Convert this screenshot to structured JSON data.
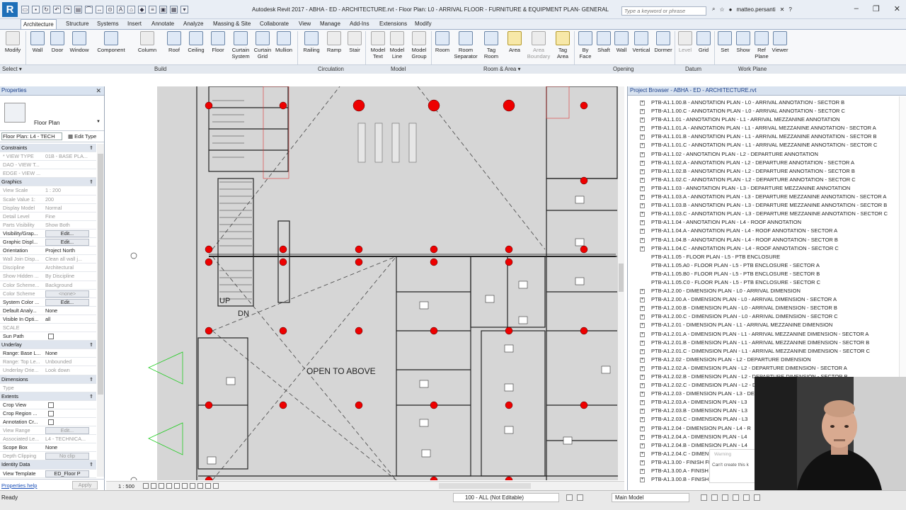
{
  "titlebar": {
    "logo": "R",
    "title": "Autodesk Revit 2017 -    ABHA - ED - ARCHITECTURE.rvt - Floor Plan: L0 - ARRIVAL FLOOR - FURNITURE & EQUIPMENT PLAN-  GENERAL",
    "search_placeholder": "Type a keyword or phrase",
    "user": "matteo.persanti",
    "minimize": "–",
    "maximize": "❐",
    "close": "✕"
  },
  "ribbon_tabs": [
    "Architecture",
    "Structure",
    "Systems",
    "Insert",
    "Annotate",
    "Analyze",
    "Massing & Site",
    "Collaborate",
    "View",
    "Manage",
    "Add-Ins",
    "Extensions",
    "Modify"
  ],
  "ribbon": {
    "buttons": [
      "Modify",
      "Wall",
      "Door",
      "Window",
      "Component",
      "Column",
      "Roof",
      "Ceiling",
      "Floor",
      "Curtain System",
      "Curtain Grid",
      "Mullion",
      "Railing",
      "Ramp",
      "Stair",
      "Model Text",
      "Model Line",
      "Model Group",
      "Room",
      "Room Separator",
      "Tag Room",
      "Area",
      "Area Boundary",
      "Tag Area",
      "By Face",
      "Shaft",
      "Wall",
      "Vertical",
      "Dormer",
      "Level",
      "Grid",
      "Set",
      "Show",
      "Ref Plane",
      "Viewer"
    ],
    "panels": [
      "Select",
      "Build",
      "Circulation",
      "Model",
      "Room & Area",
      "Opening",
      "Datum",
      "Work Plane"
    ]
  },
  "properties": {
    "title": "Properties",
    "type_name": "Floor Plan",
    "instance": "Floor Plan: L4 - TECH",
    "edit_type": "Edit Type",
    "rows": [
      {
        "k": "Constraints",
        "sec": true
      },
      {
        "k": "* VIEW TYPE",
        "v": "01B - BASE PLA...",
        "grey": true
      },
      {
        "k": "DAO - VIEW T...",
        "v": "",
        "grey": true
      },
      {
        "k": "EDGE - VIEW ...",
        "v": "",
        "grey": true
      },
      {
        "k": "Graphics",
        "sec": true
      },
      {
        "k": "View Scale",
        "v": "1 : 200",
        "grey": true
      },
      {
        "k": "Scale Value    1:",
        "v": "200",
        "grey": true
      },
      {
        "k": "Display Model",
        "v": "Normal",
        "grey": true
      },
      {
        "k": "Detail Level",
        "v": "Fine",
        "grey": true
      },
      {
        "k": "Parts Visibility",
        "v": "Show Both",
        "grey": true
      },
      {
        "k": "Visibility/Grap...",
        "v": "Edit...",
        "btn": true
      },
      {
        "k": "Graphic Displ...",
        "v": "Edit...",
        "btn": true
      },
      {
        "k": "Orientation",
        "v": "Project North"
      },
      {
        "k": "Wall Join Disp...",
        "v": "Clean all wall j...",
        "grey": true
      },
      {
        "k": "Discipline",
        "v": "Architectural",
        "grey": true
      },
      {
        "k": "Show Hidden ...",
        "v": "By Discipline",
        "grey": true
      },
      {
        "k": "Color Scheme...",
        "v": "Background",
        "grey": true
      },
      {
        "k": "Color Scheme",
        "v": "<none>",
        "btn": true,
        "grey": true
      },
      {
        "k": "System Color ...",
        "v": "Edit...",
        "btn": true
      },
      {
        "k": "Default Analy...",
        "v": "None"
      },
      {
        "k": "Visible In Opti...",
        "v": "all"
      },
      {
        "k": "SCALE",
        "v": "",
        "grey": true
      },
      {
        "k": "Sun Path",
        "v": "",
        "chk": true
      },
      {
        "k": "Underlay",
        "sec": true
      },
      {
        "k": "Range: Base L...",
        "v": "None"
      },
      {
        "k": "Range: Top Le...",
        "v": "Unbounded",
        "grey": true
      },
      {
        "k": "Underlay Orie...",
        "v": "Look down",
        "grey": true
      },
      {
        "k": "Dimensions",
        "sec": true
      },
      {
        "k": "Type",
        "v": "",
        "grey": true
      },
      {
        "k": "Extents",
        "sec": true
      },
      {
        "k": "Crop View",
        "v": "",
        "chk": true
      },
      {
        "k": "Crop Region ...",
        "v": "",
        "chk": true
      },
      {
        "k": "Annotation Cr...",
        "v": "",
        "chk": true
      },
      {
        "k": "View Range",
        "v": "Edit...",
        "btn": true,
        "grey": true
      },
      {
        "k": "Associated Le...",
        "v": "L4 - TECHNICA...",
        "grey": true
      },
      {
        "k": "Scope Box",
        "v": "None"
      },
      {
        "k": "Depth Clipping",
        "v": "No clip",
        "btn": true,
        "grey": true
      },
      {
        "k": "Identity Data",
        "sec": true
      },
      {
        "k": "View Template",
        "v": "ED_Floor P",
        "btn": true
      }
    ],
    "help": "Properties help",
    "apply": "Apply"
  },
  "canvas": {
    "label_open": "OPEN TO ABOVE",
    "label_up": "UP",
    "label_dn": "DN",
    "scale": "1 : 500"
  },
  "browser": {
    "title": "Project Browser - ABHA - ED - ARCHITECTURE.rvt",
    "items": [
      "PTB-A1.1.00.B - ANNOTATION PLAN - L0 - ARRIVAL ANNOTATION - SECTOR B",
      "PTB-A1.1.00.C - ANNOTATION PLAN - L0 - ARRIVAL ANNOTATION - SECTOR C",
      "PTB-A1.1.01 - ANNOTATION PLAN - L1 - ARRIVAL MEZZANINE ANNOTATION",
      "PTB-A1.1.01.A - ANNOTATION PLAN - L1 - ARRIVAL MEZZANINE ANNOTATION - SECTOR A",
      "PTB-A1.1.01.B - ANNOTATION PLAN - L1 - ARRIVAL MEZZANINE ANNOTATION - SECTOR B",
      "PTB-A1.1.01.C - ANNOTATION PLAN - L1 - ARRIVAL MEZZANINE ANNOTATION - SECTOR C",
      "PTB-A1.1.02 - ANNOTATION PLAN - L2 - DEPARTURE ANNOTATION",
      "PTB-A1.1.02.A - ANNOTATION PLAN - L2 - DEPARTURE ANNOTATION - SECTOR A",
      "PTB-A1.1.02.B - ANNOTATION PLAN - L2 - DEPARTURE ANNOTATION - SECTOR B",
      "PTB-A1.1.02.C - ANNOTATION PLAN - L2 - DEPARTURE ANNOTATION - SECTOR C",
      "PTB-A1.1.03 - ANNOTATION PLAN - L3 - DEPARTURE MEZZANINE ANNOTATION",
      "PTB-A1.1.03.A - ANNOTATION PLAN - L3 - DEPARTURE MEZZANINE ANNOTATION - SECTOR A",
      "PTB-A1.1.03.B - ANNOTATION PLAN - L3 - DEPARTURE MEZZANINE ANNOTATION - SECTOR B",
      "PTB-A1.1.03.C - ANNOTATION PLAN - L3 - DEPARTURE MEZZANINE ANNOTATION - SECTOR C",
      "PTB-A1.1.04 - ANNOTATION PLAN - L4 - ROOF ANNOTATION",
      "PTB-A1.1.04.A - ANNOTATION PLAN - L4 - ROOF ANNOTATION - SECTOR A",
      "PTB-A1.1.04.B - ANNOTATION PLAN - L4 - ROOF ANNOTATION - SECTOR B",
      "PTB-A1.1.04.C - ANNOTATION PLAN - L4 - ROOF ANNOTATION - SECTOR C",
      "PTB-A1.1.05 - FLOOR PLAN - L5 - PTB ENCLOSURE",
      "PTB-A1.1.05.A0 - FLOOR PLAN - L5 - PTB ENCLOSURE - SECTOR A",
      "PTB-A1.1.05.B0 - FLOOR PLAN - L5 - PTB ENCLOSURE - SECTOR B",
      "PTB-A1.1.05.C0 - FLOOR PLAN - L5 - PTB ENCLOSURE - SECTOR C",
      "PTB-A1.2.00 - DIMENSION PLAN - L0 - ARRIVAL DIMENSION",
      "PTB-A1.2.00.A - DIMENSION PLAN - L0 - ARRIVAL DIMENSION - SECTOR A",
      "PTB-A1.2.00.B - DIMENSION PLAN - L0 - ARRIVAL DIMENSION - SECTOR B",
      "PTB-A1.2.00.C - DIMENSION PLAN - L0 - ARRIVAL DIMENSION - SECTOR C",
      "PTB-A1.2.01 - DIMENSION PLAN - L1 - ARRIVAL MEZZANINE DIMENSION",
      "PTB-A1.2.01.A - DIMENSION PLAN - L1 - ARRIVAL MEZZANINE DIMENSION - SECTOR A",
      "PTB-A1.2.01.B - DIMENSION PLAN - L1 - ARRIVAL MEZZANINE DIMENSION - SECTOR B",
      "PTB-A1.2.01.C - DIMENSION PLAN - L1 - ARRIVAL MEZZANINE DIMENSION - SECTOR C",
      "PTB-A1.2.02 - DIMENSION PLAN - L2 - DEPARTURE DIMENSION",
      "PTB-A1.2.02.A - DIMENSION PLAN - L2 - DEPARTURE DIMENSION - SECTOR A",
      "PTB-A1.2.02.B - DIMENSION PLAN - L2 - DEPARTURE DIMENSION - SECTOR B",
      "PTB-A1.2.02.C - DIMENSION PLAN - L2 - DEPA",
      "PTB-A1.2.03 - DIMENSION PLAN - L3 - DEP",
      "PTB-A1.2.03.A - DIMENSION PLAN - L3",
      "PTB-A1.2.03.B - DIMENSION PLAN - L3",
      "PTB-A1.2.03.C - DIMENSION PLAN - L3",
      "PTB-A1.2.04 - DIMENSION PLAN - L4 - R",
      "PTB-A1.2.04.A - DIMENSION PLAN - L4",
      "PTB-A1.2.04.B - DIMENSION PLAN - L4",
      "PTB-A1.2.04.C - DIMEN",
      "PTB-A1.3.00 - FINISH FL",
      "PTB-A1.3.00.A - FINISH",
      "PTB-A1.3.00.B - FINISH"
    ]
  },
  "warning": {
    "title": "Warning",
    "message": "Can't create this k"
  },
  "statusbar": {
    "status": "Ready",
    "workset": "100 - ALL (Not Editable)",
    "model": "Main Model"
  }
}
